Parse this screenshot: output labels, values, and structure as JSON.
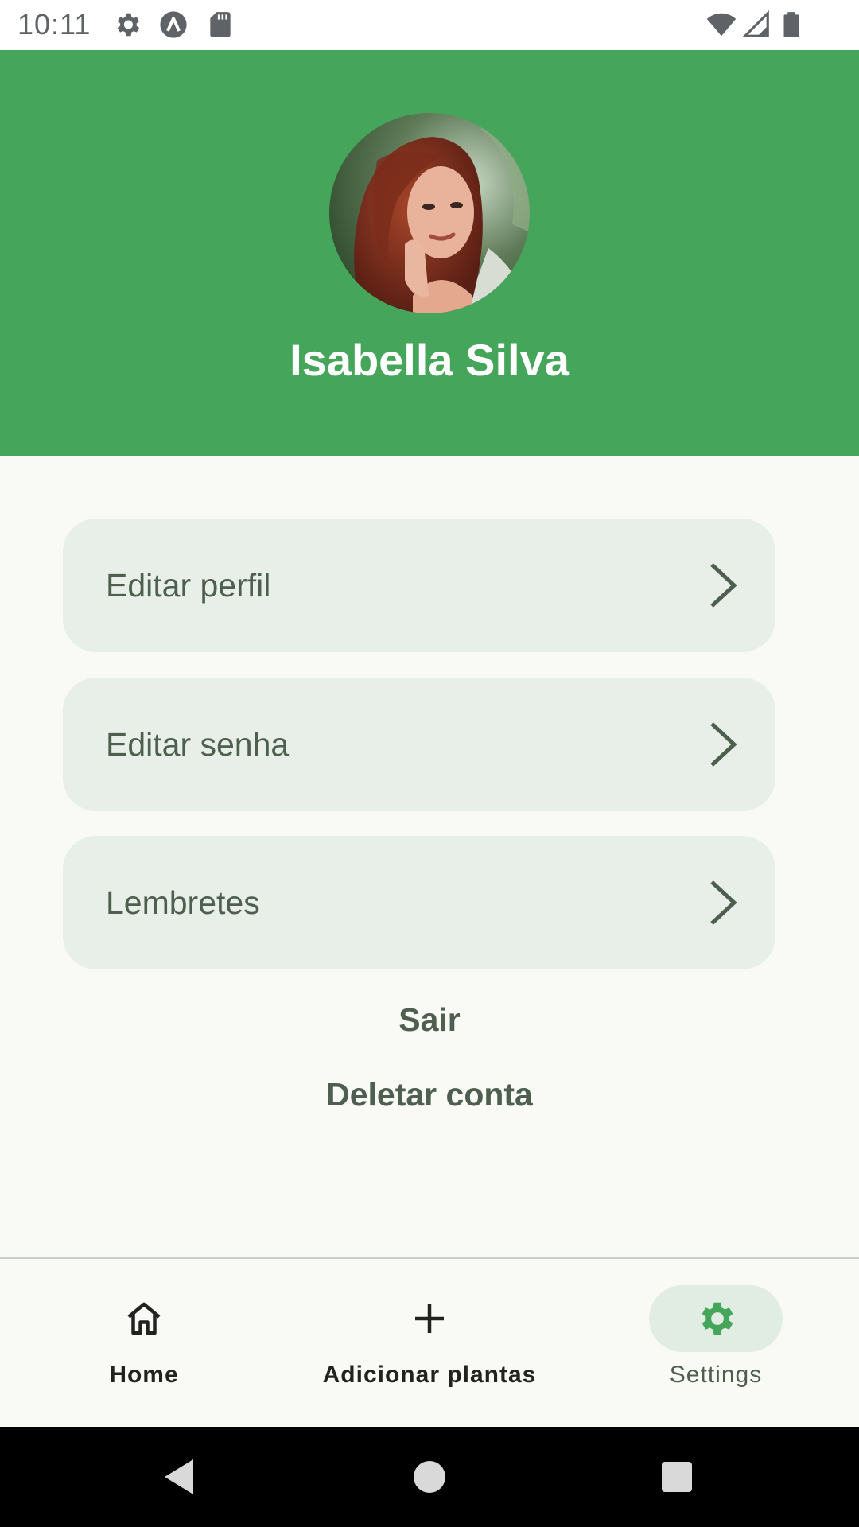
{
  "status_bar": {
    "time": "10:11",
    "icons": [
      "settings-icon",
      "app-a-icon",
      "sd-card-icon",
      "wifi-icon",
      "signal-icon",
      "battery-icon"
    ]
  },
  "profile": {
    "name": "Isabella Silva",
    "header_color": "#45a55a"
  },
  "menu": {
    "items": [
      {
        "label": "Editar perfil"
      },
      {
        "label": "Editar senha"
      },
      {
        "label": "Lembretes"
      }
    ]
  },
  "actions": {
    "logout": "Sair",
    "delete_account": "Deletar conta"
  },
  "bottom_nav": {
    "items": [
      {
        "label": "Home",
        "icon": "home-icon"
      },
      {
        "label": "Adicionar plantas",
        "icon": "plus-icon"
      },
      {
        "label": "Settings",
        "icon": "gear-icon",
        "active": true
      }
    ],
    "active_color": "#45a55a"
  },
  "system_nav": [
    "back",
    "home",
    "recents"
  ]
}
